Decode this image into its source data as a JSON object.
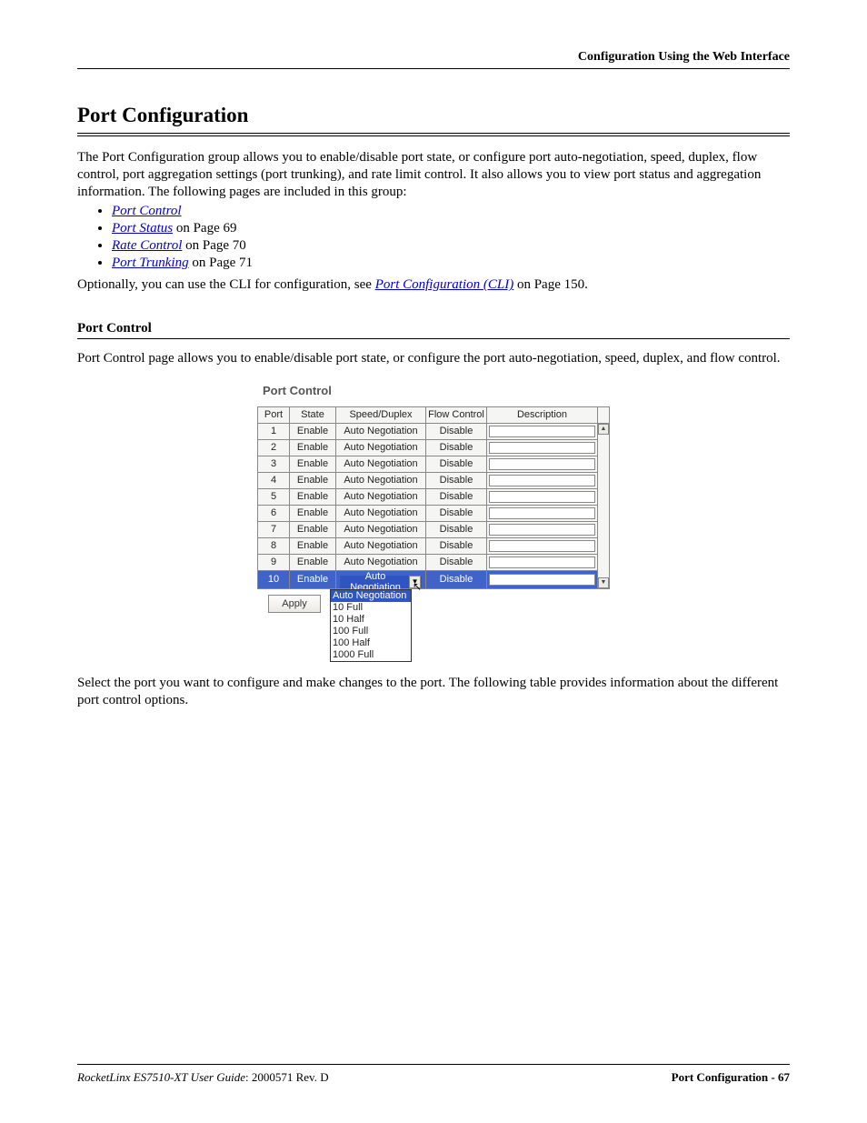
{
  "header": {
    "right": "Configuration Using the Web Interface"
  },
  "title": "Port Configuration",
  "intro": "The Port Configuration group allows you to enable/disable port state, or configure port auto-negotiation, speed, duplex, flow control, port aggregation settings (port trunking), and rate limit control. It also allows you to view port status and aggregation information. The following pages are included in this group:",
  "links": {
    "items": [
      {
        "text": "Port Control",
        "suffix": ""
      },
      {
        "text": "Port Status",
        "suffix": " on Page 69"
      },
      {
        "text": "Rate Control",
        "suffix": " on Page 70"
      },
      {
        "text": "Port Trunking",
        "suffix": " on Page 71"
      }
    ]
  },
  "optional_line_pre": "Optionally, you can use the CLI for configuration, see ",
  "optional_link": "Port Configuration (CLI)",
  "optional_line_post": " on Page 150.",
  "sub": {
    "heading": "Port Control",
    "text": "Port Control page allows you to enable/disable port state, or configure the port auto-negotiation, speed, duplex, and flow control."
  },
  "screenshot": {
    "title": "Port Control",
    "headers": {
      "port": "Port",
      "state": "State",
      "sd": "Speed/Duplex",
      "fc": "Flow Control",
      "desc": "Description"
    },
    "rows": [
      {
        "port": "1",
        "state": "Enable",
        "sd": "Auto Negotiation",
        "fc": "Disable",
        "selected": false
      },
      {
        "port": "2",
        "state": "Enable",
        "sd": "Auto Negotiation",
        "fc": "Disable",
        "selected": false
      },
      {
        "port": "3",
        "state": "Enable",
        "sd": "Auto Negotiation",
        "fc": "Disable",
        "selected": false
      },
      {
        "port": "4",
        "state": "Enable",
        "sd": "Auto Negotiation",
        "fc": "Disable",
        "selected": false
      },
      {
        "port": "5",
        "state": "Enable",
        "sd": "Auto Negotiation",
        "fc": "Disable",
        "selected": false
      },
      {
        "port": "6",
        "state": "Enable",
        "sd": "Auto Negotiation",
        "fc": "Disable",
        "selected": false
      },
      {
        "port": "7",
        "state": "Enable",
        "sd": "Auto Negotiation",
        "fc": "Disable",
        "selected": false
      },
      {
        "port": "8",
        "state": "Enable",
        "sd": "Auto Negotiation",
        "fc": "Disable",
        "selected": false
      },
      {
        "port": "9",
        "state": "Enable",
        "sd": "Auto Negotiation",
        "fc": "Disable",
        "selected": false
      },
      {
        "port": "10",
        "state": "Enable",
        "sd": "Auto Negotiation",
        "fc": "Disable",
        "selected": true
      }
    ],
    "apply": "Apply",
    "dropdown": [
      "Auto Negotiation",
      "10 Full",
      "10 Half",
      "100 Full",
      "100 Half",
      "1000 Full"
    ]
  },
  "after_shot": "Select the port you want to configure and make changes to the port. The following table provides information about the different port control options.",
  "footer": {
    "left_italic": "RocketLinx ES7510-XT  User Guide",
    "left_rest": ": 2000571 Rev. D",
    "right": "Port Configuration - 67"
  }
}
